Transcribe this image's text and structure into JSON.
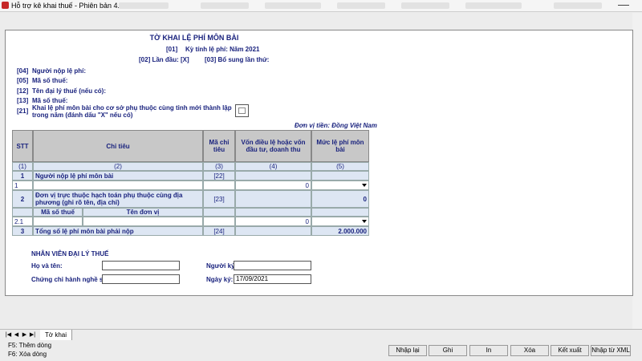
{
  "window": {
    "title": "Hỗ trợ kê khai thuế - Phiên bản 4.5.9"
  },
  "form": {
    "title": "TỜ KHAI LỆ PHÍ MÔN BÀI",
    "period_code": "[01]",
    "period_label": "Kỳ tính lệ phí: Năm 2021",
    "first_time_code": "[02] Lần đầu:",
    "first_time_value": "[X]",
    "supplement_label": "[03] Bổ sung lần thứ:",
    "fields": [
      {
        "code": "[04]",
        "label": "Người nộp lệ phí:"
      },
      {
        "code": "[05]",
        "label": "Mã số thuế:"
      },
      {
        "code": "[12]",
        "label": "Tên đại lý thuế (nếu có):"
      },
      {
        "code": "[13]",
        "label": "Mã số thuế:"
      },
      {
        "code": "[21]",
        "label": "Khai lệ phí môn bài cho cơ sở phụ thuộc cùng tỉnh mới thành lập trong năm (đánh dấu \"X\" nếu có)"
      }
    ],
    "currency_note": "Đơn vị tiền: Đồng Việt Nam"
  },
  "table": {
    "headers": [
      "STT",
      "Chỉ tiêu",
      "Mã chỉ tiêu",
      "Vốn điều lệ hoặc vốn đầu tư, doanh thu",
      "Mức lệ phí môn bài"
    ],
    "index_row": [
      "(1)",
      "(2)",
      "(3)",
      "(4)",
      "(5)"
    ],
    "row1": {
      "stt": "1",
      "label": "Người nộp lệ phí môn bài",
      "code": "[22]"
    },
    "row1_detail": {
      "stt": "1",
      "capital": "0"
    },
    "row2": {
      "stt": "2",
      "label": "Đơn vị trực thuộc hạch toán phụ thuộc cùng địa phương (ghi rõ tên, địa chỉ)",
      "code": "[23]",
      "fee": "0"
    },
    "row2_sub": {
      "col_tax": "Mã số thuế",
      "col_name": "Tên đơn vị"
    },
    "row2_detail": {
      "stt": "2.1",
      "capital": "0"
    },
    "row3": {
      "stt": "3",
      "label": "Tổng số lệ phí môn bài phải nộp",
      "code": "[24]",
      "fee": "2.000.000"
    }
  },
  "agent": {
    "heading": "NHÂN VIÊN ĐẠI LÝ THUẾ",
    "name_label": "Họ và tên:",
    "cert_label": "Chứng chỉ hành nghề số:",
    "signer_label": "Người ký:",
    "date_label": "Ngày ký:",
    "date_value": "17/09/2021"
  },
  "tabs": {
    "active": "Tờ khai"
  },
  "hints": [
    "F5: Thêm dòng",
    "F6: Xóa dòng"
  ],
  "buttons": [
    "Nhập lại",
    "Ghi",
    "In",
    "Xóa",
    "Kết xuất",
    "Nhập từ XML"
  ]
}
